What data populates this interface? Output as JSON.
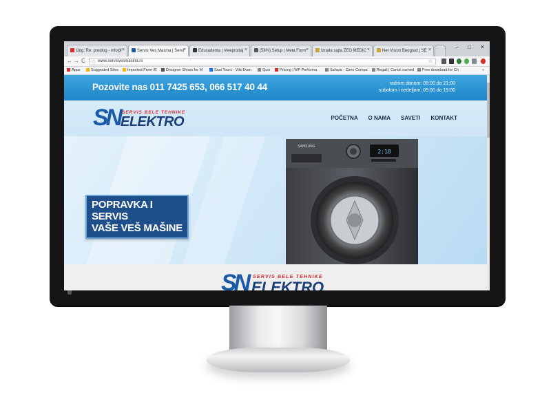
{
  "browser": {
    "tabs": [
      {
        "label": "Odg: Re: predlog - info@",
        "favicon_color": "#d93025"
      },
      {
        "label": "Servis Ves Masina | Servi",
        "favicon_color": "#1a5aa6",
        "active": true
      },
      {
        "label": "Educadenta | Veleprodaj",
        "favicon_color": "#333333"
      },
      {
        "label": "(58%) Setup | Meta Form",
        "favicon_color": "#555555"
      },
      {
        "label": "Izrada sajta ZEO MEDIC",
        "favicon_color": "#c9a63b"
      },
      {
        "label": "Net Vision Beograd | SE",
        "favicon_color": "#c9a63b"
      }
    ],
    "window_controls": {
      "minimize": "−",
      "maximize": "□",
      "close": "✕"
    },
    "nav": {
      "back": "←",
      "forward": "→",
      "reload": "C"
    },
    "address": "www.servisvesmasina.rs",
    "bookmarks": [
      {
        "label": "Apps",
        "color": "#d93025"
      },
      {
        "label": "Suggested Sites",
        "color": "#f4b400"
      },
      {
        "label": "Imported From IE",
        "color": "#f4b400"
      },
      {
        "label": "Designer Shoes for M",
        "color": "#555555"
      },
      {
        "label": "Sani Tours - Vila Evan",
        "color": "#1a73e8"
      },
      {
        "label": "Quix",
        "color": "#888888"
      },
      {
        "label": "Pricing | WP Performa",
        "color": "#d93025"
      },
      {
        "label": "Sahara - Cimo Compa",
        "color": "#888888"
      },
      {
        "label": "Regali | Čarkić named",
        "color": "#888888"
      },
      {
        "label": "Free download for Ch",
        "color": "#888888"
      }
    ],
    "more_bookmarks": "»"
  },
  "site": {
    "phone_text": "Pozovite nas 011 7425 653, 066 517 40 44",
    "hours_weekday": "radnim danom: 09:00 do 21:00",
    "hours_weekend": "subotom i nedeljom: 09:00 do 19:00",
    "logo": {
      "mark": "SN",
      "tagline": "SERVIS BELE TEHNIKE",
      "name": "ELEKTRO"
    },
    "nav": [
      "POČETNA",
      "O NAMA",
      "SAVETI",
      "KONTAKT"
    ],
    "hero_line1": "POPRAVKA I SERVIS",
    "hero_line2": "VAŠE VEŠ MAŠINE",
    "washer_brand": "SAMSUNG",
    "accent_color": "#1e86c8",
    "brand_red": "#d9282f",
    "brand_blue": "#1a5aa6"
  }
}
